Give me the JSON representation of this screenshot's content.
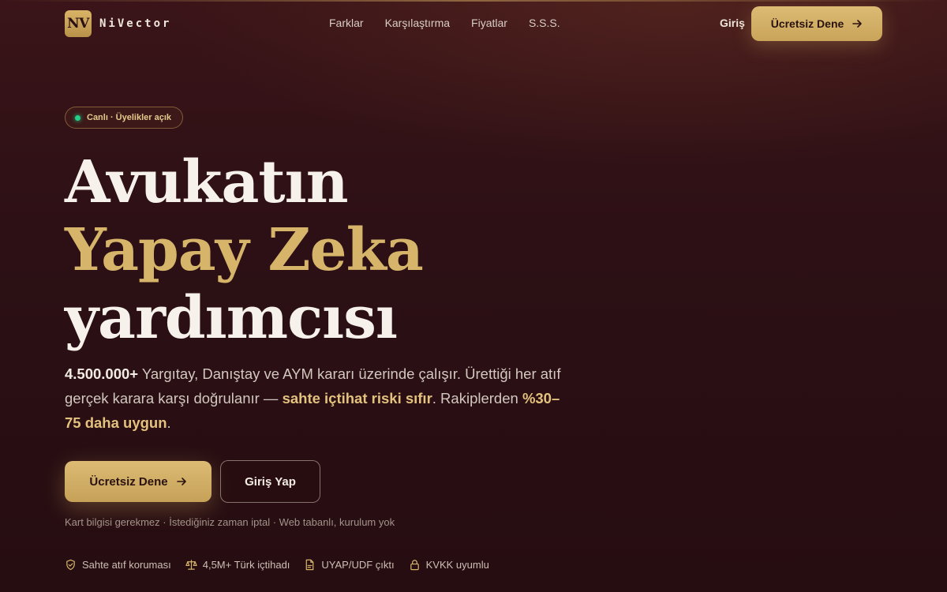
{
  "brand": {
    "mark": "NV",
    "name": "NiVector"
  },
  "nav": {
    "links": [
      "Farklar",
      "Karşılaştırma",
      "Fiyatlar",
      "S.S.S."
    ],
    "login": "Giriş",
    "cta": "Ücretsiz Dene"
  },
  "hero": {
    "badge": "Canlı · Üyelikler açık",
    "headline": {
      "line1": "Avukatın",
      "line2": "Yapay Zeka",
      "line3": "yardımcısı"
    },
    "description": {
      "count": "4.500.000+",
      "part1": " Yargıtay, Danıştay ve AYM kararı üzerinde çalışır. Ürettiği her atıf gerçek karara karşı doğrulanır — ",
      "highlight1": "sahte içtihat riski sıfır",
      "part2": ". Rakiplerden ",
      "highlight2": "%30–75 daha uygun",
      "part3": "."
    },
    "primary_button": "Ücretsiz Dene",
    "secondary_button": "Giriş Yap",
    "fineprint": "Kart bilgisi gerekmez · İstediğiniz zaman iptal · Web tabanlı, kurulum yok"
  },
  "features": [
    {
      "icon": "shield-icon",
      "label": "Sahte atıf koruması"
    },
    {
      "icon": "scales-icon",
      "label": "4,5M+ Türk içtihadı"
    },
    {
      "icon": "document-icon",
      "label": "UYAP/UDF çıktı"
    },
    {
      "icon": "lock-icon",
      "label": "KVKK uyumlu"
    }
  ],
  "colors": {
    "background": "#2a0f14",
    "accent": "#d6b46a",
    "live": "#22d08a"
  }
}
